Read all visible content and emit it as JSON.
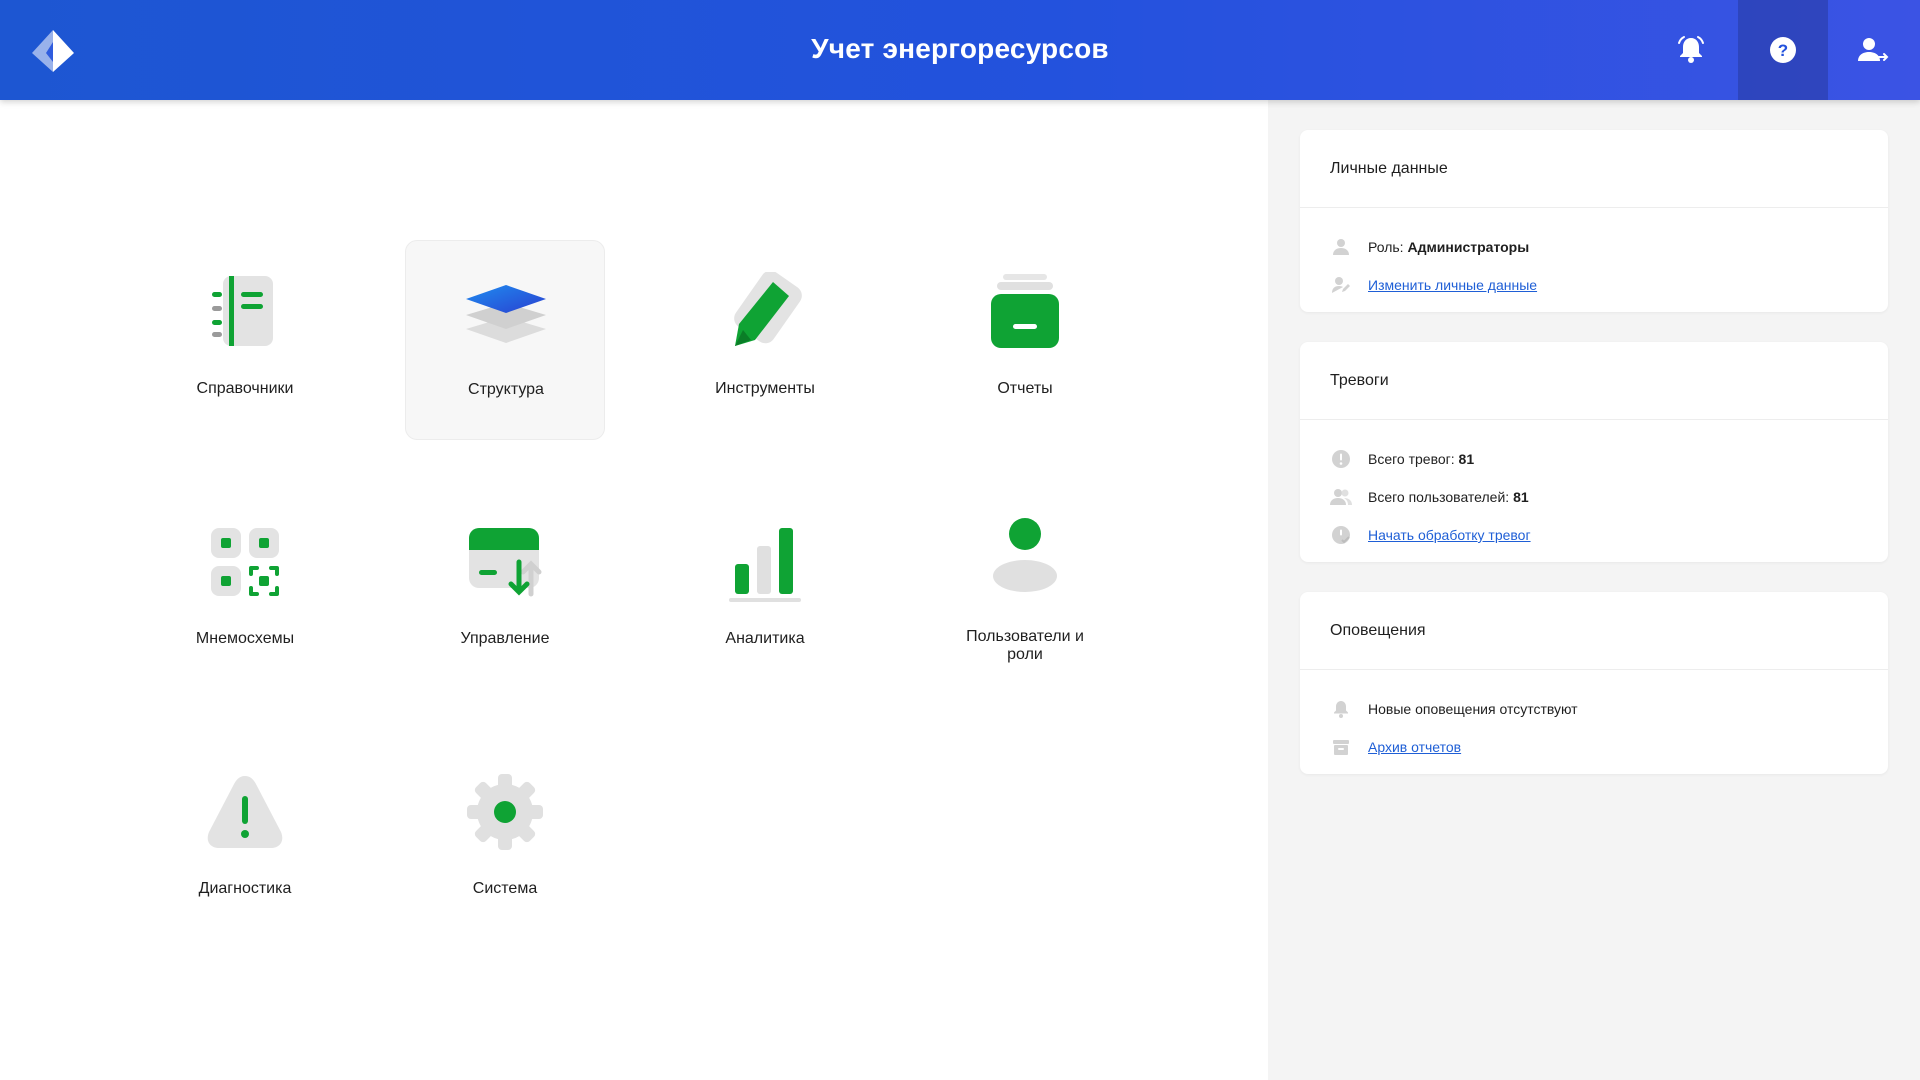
{
  "header": {
    "title": "Учет энергоресурсов",
    "logo": "app-logo",
    "buttons": [
      "bell-icon",
      "help-icon",
      "user-login-icon"
    ],
    "color": "#2352dd"
  },
  "tiles": [
    {
      "label": "Справочники",
      "icon": "directory-icon"
    },
    {
      "label": "Структура",
      "icon": "layers-icon",
      "active": true
    },
    {
      "label": "Инструменты",
      "icon": "pencil-icon"
    },
    {
      "label": "Отчеты",
      "icon": "reports-icon"
    },
    {
      "label": "Мнемосхемы",
      "icon": "mnemonic-icon"
    },
    {
      "label": "Управление",
      "icon": "control-icon"
    },
    {
      "label": "Аналитика",
      "icon": "analytics-icon"
    },
    {
      "label": "Пользователи и роли",
      "icon": "users-icon"
    },
    {
      "label": "Диагностика",
      "icon": "warning-icon"
    },
    {
      "label": "Система",
      "icon": "gear-icon"
    }
  ],
  "accent_green": "#0fa334",
  "personal": {
    "title": "Личные данные",
    "role_label": "Роль:",
    "role_value": "Администраторы",
    "edit_link": "Изменить личные данные"
  },
  "alarms": {
    "title": "Тревоги",
    "total_label": "Всего тревог:",
    "total_value": "81",
    "users_label": "Всего пользователей:",
    "users_value": "81",
    "process_link": "Начать обработку тревог"
  },
  "notifications": {
    "title": "Оповещения",
    "none_text": "Новые оповещения отсутствуют",
    "archive_link": "Архив отчетов"
  }
}
